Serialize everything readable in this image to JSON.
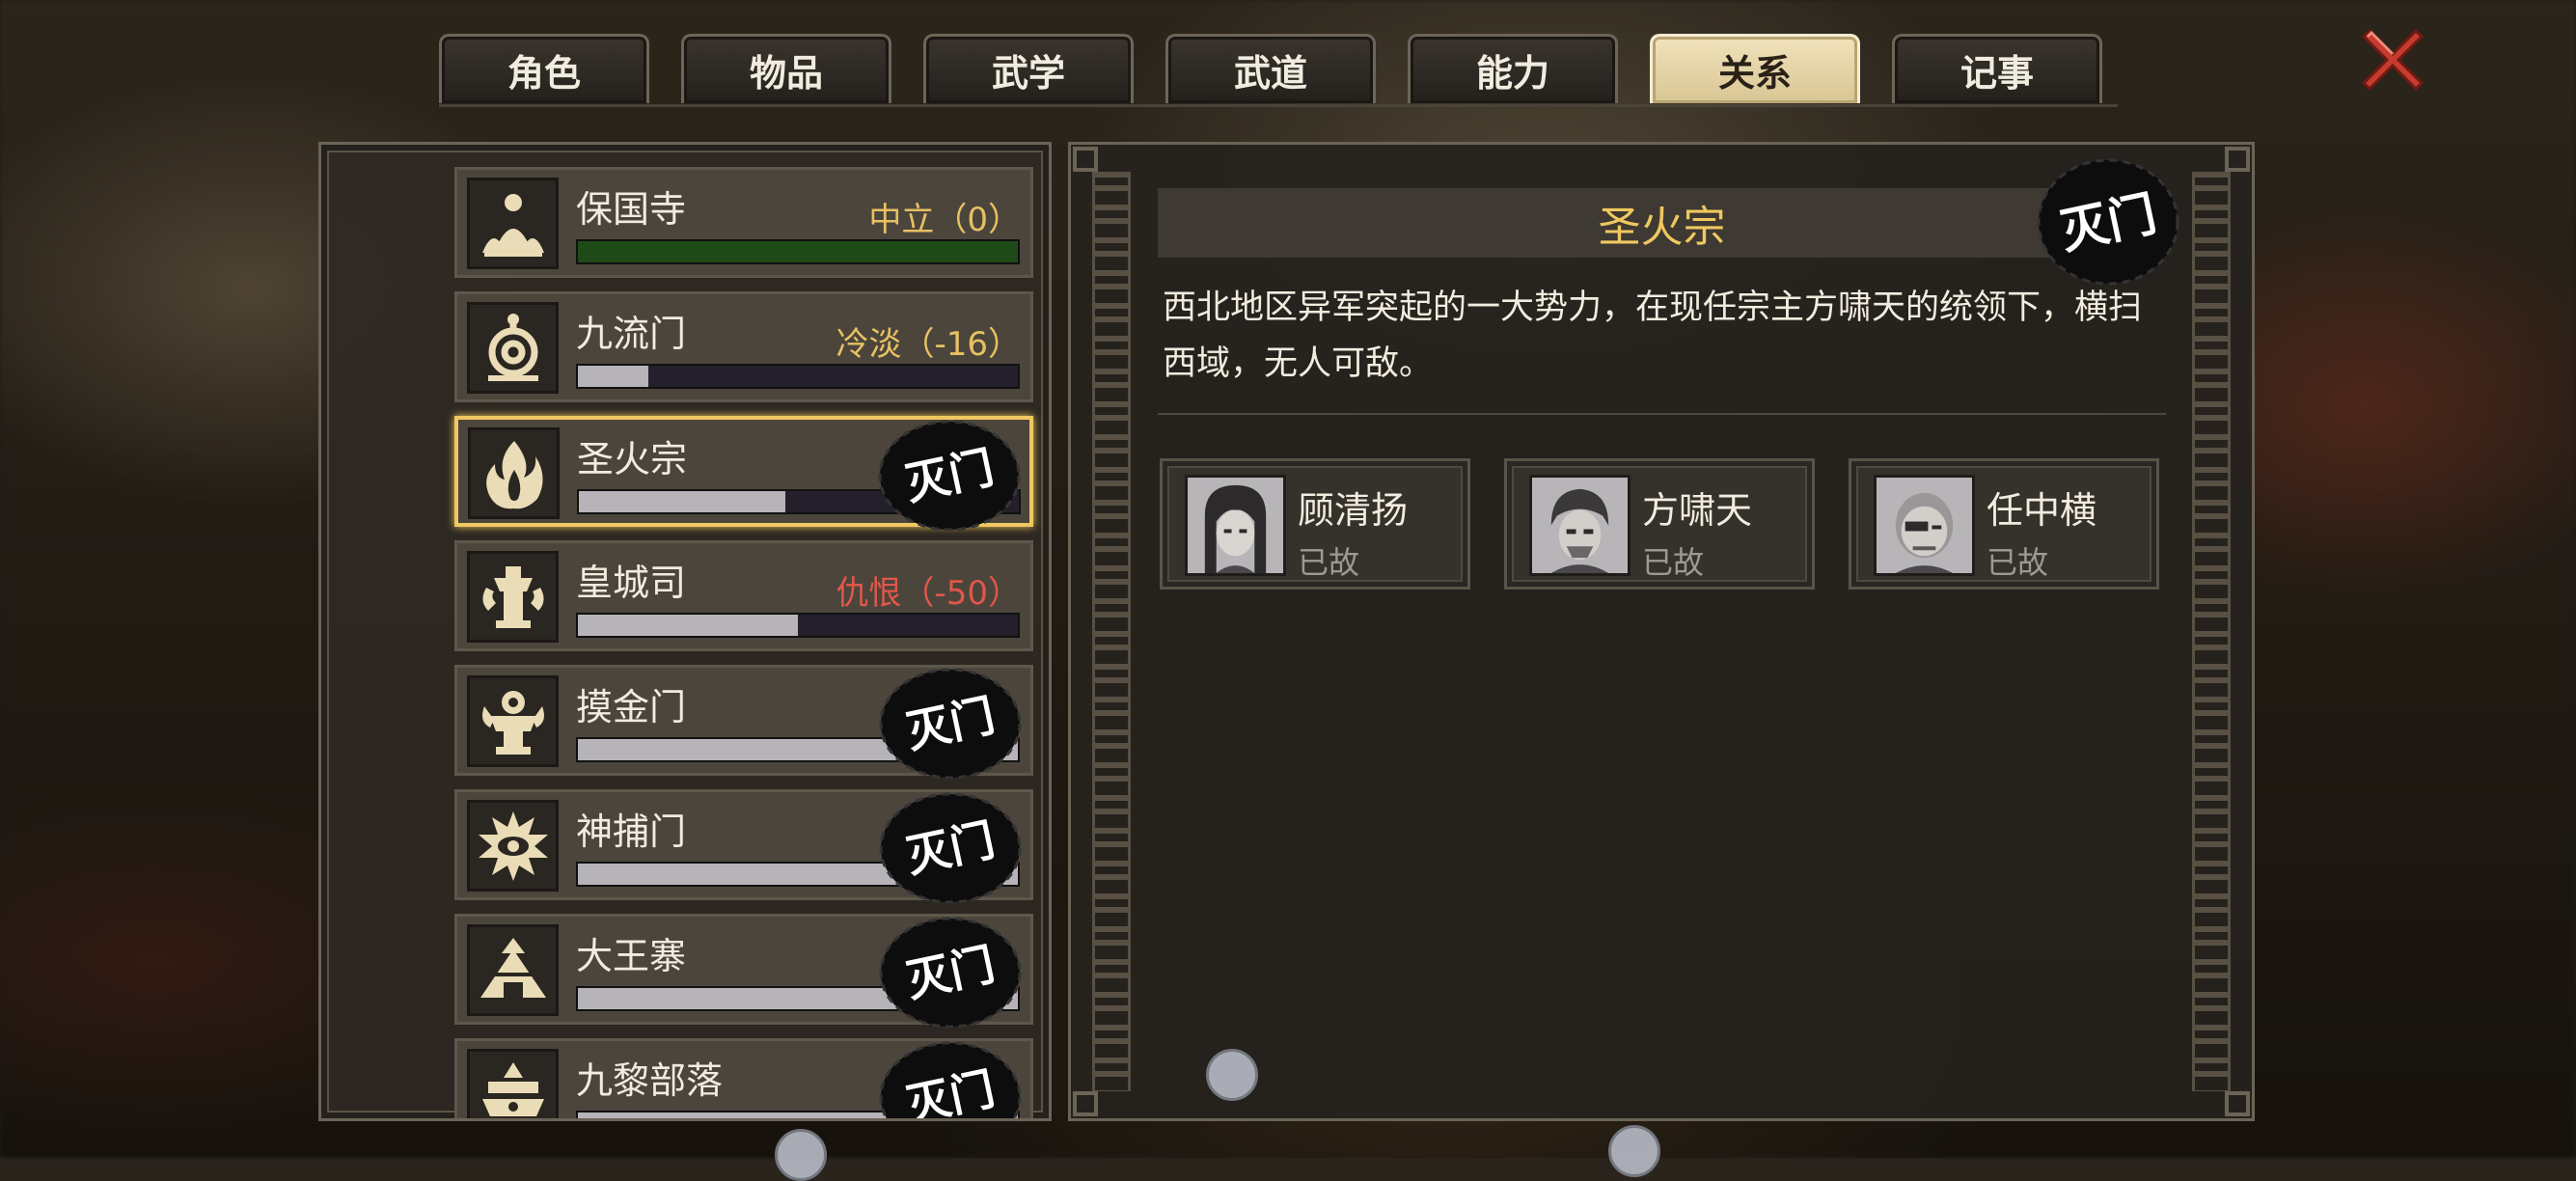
{
  "tabs": [
    {
      "label": "角色",
      "active": false
    },
    {
      "label": "物品",
      "active": false
    },
    {
      "label": "武学",
      "active": false
    },
    {
      "label": "武道",
      "active": false
    },
    {
      "label": "能力",
      "active": false
    },
    {
      "label": "关系",
      "active": true
    },
    {
      "label": "记事",
      "active": false
    }
  ],
  "stamp_text": "灭门",
  "factions": [
    {
      "name": "保国寺",
      "status": "中立（0）",
      "status_color": "#e7c162",
      "bar_color": "#1e4a17",
      "bar_fill": 1.0,
      "destroyed": false
    },
    {
      "name": "九流门",
      "status": "冷淡（-16）",
      "status_color": "#e7c162",
      "bar_color": "#b6b3b9",
      "bar_fill": 0.16,
      "destroyed": false
    },
    {
      "name": "圣火宗",
      "status": "",
      "status_color": "#e7c162",
      "bar_color": "#b6b3b9",
      "bar_fill": 0.47,
      "destroyed": true,
      "selected": true
    },
    {
      "name": "皇城司",
      "status": "仇恨（-50）",
      "status_color": "#e0574a",
      "bar_color": "#b6b3b9",
      "bar_fill": 0.5,
      "destroyed": false
    },
    {
      "name": "摸金门",
      "status": "",
      "status_color": "#e7c162",
      "bar_color": "#b6b3b9",
      "bar_fill": 1.0,
      "destroyed": true
    },
    {
      "name": "神捕门",
      "status": "",
      "status_color": "#e7c162",
      "bar_color": "#b6b3b9",
      "bar_fill": 1.0,
      "destroyed": true
    },
    {
      "name": "大王寨",
      "status": "",
      "status_color": "#e7c162",
      "bar_color": "#b6b3b9",
      "bar_fill": 1.0,
      "destroyed": true
    },
    {
      "name": "九黎部落",
      "status": "",
      "status_color": "#e7c162",
      "bar_color": "#b6b3b9",
      "bar_fill": 1.0,
      "destroyed": true
    }
  ],
  "detail": {
    "title": "圣火宗",
    "description": "西北地区异军突起的一大势力，在现任宗主方啸天的统领下，横扫西域，无人可敌。",
    "members": [
      {
        "name": "顾清扬",
        "status": "已故"
      },
      {
        "name": "方啸天",
        "status": "已故"
      },
      {
        "name": "任中横",
        "status": "已故"
      }
    ]
  },
  "colors": {
    "accent": "#f0c860",
    "close": "#c0392b"
  }
}
